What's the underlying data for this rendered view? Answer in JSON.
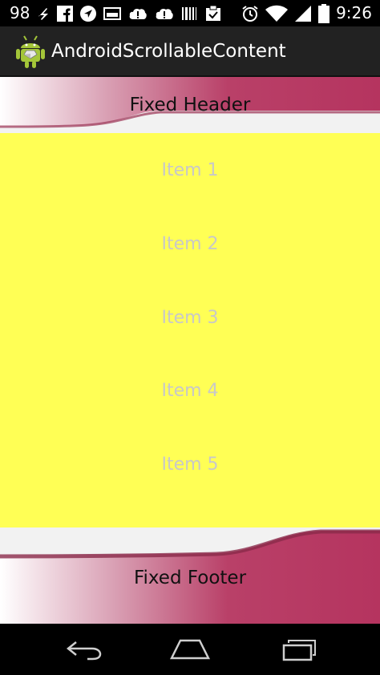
{
  "status_bar": {
    "notification_count": "98",
    "clock": "9:26",
    "icons": [
      "notification-98",
      "arrow-icon",
      "facebook-icon",
      "navigation-icon",
      "gallery-icon",
      "alert-icon",
      "alert-icon",
      "barcode-icon",
      "task-icon",
      "alarm-icon",
      "wifi-icon",
      "signal-icon",
      "battery-icon"
    ]
  },
  "action_bar": {
    "title": "AndroidScrollableContent",
    "icon": "android-icon"
  },
  "header": {
    "label": "Fixed Header"
  },
  "content": {
    "background": "#ffff55",
    "items": [
      "Item 1",
      "Item 2",
      "Item 3",
      "Item 4",
      "Item 5"
    ]
  },
  "footer": {
    "label": "Fixed Footer"
  },
  "colors": {
    "accent": "#b5345f",
    "item_text": "#c8c8c8"
  },
  "nav_bar": {
    "buttons": [
      "back-icon",
      "home-icon",
      "recent-apps-icon"
    ]
  }
}
